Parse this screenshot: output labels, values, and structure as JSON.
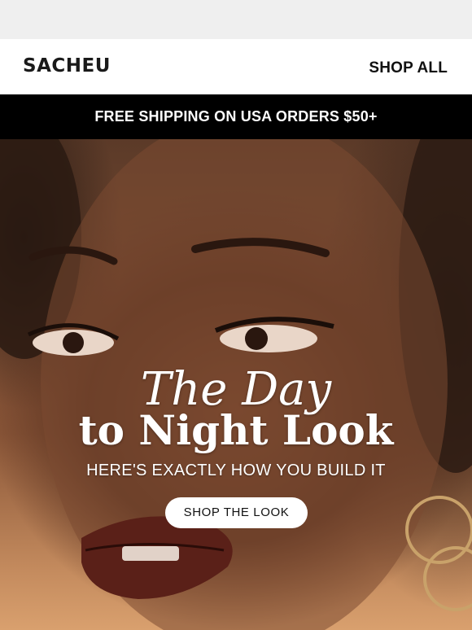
{
  "header": {
    "logo_text": "SACHEU",
    "shop_all_label": "SHOP ALL"
  },
  "banner": {
    "text": "FREE SHIPPING ON USA ORDERS $50+"
  },
  "hero": {
    "title_line1": "The Day",
    "title_line2": "to Night Look",
    "subtitle": "HERE'S EXACTLY HOW YOU BUILD IT",
    "cta_label": "SHOP THE LOOK"
  }
}
